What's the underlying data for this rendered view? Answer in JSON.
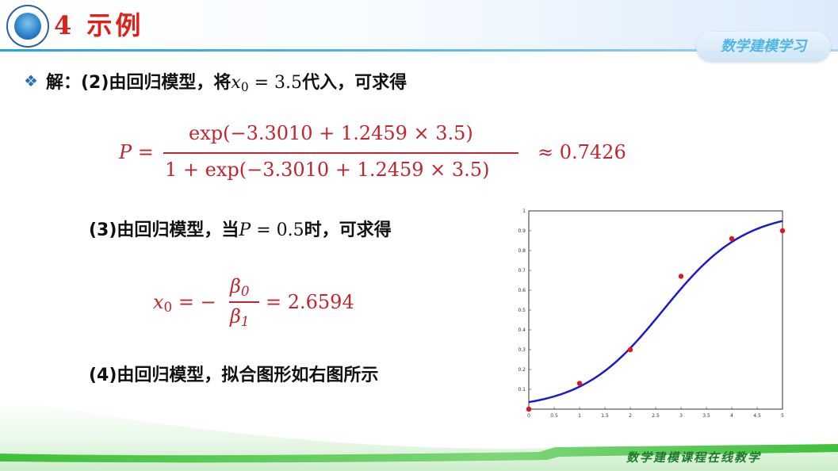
{
  "header": {
    "section_title": "4 示例",
    "course_badge": "数学建模学习"
  },
  "content": {
    "bullet_icon": "diamond-bullet-icon",
    "line1_prefix": "解：(2)由回归模型，将",
    "line1_var": "x",
    "line1_sub": "0",
    "line1_value": " = 3.5",
    "line1_suffix": "代入，可求得",
    "eq_p": {
      "lhs": "P =",
      "numerator": "exp(−3.3010 + 1.2459 × 3.5)",
      "denominator": "1 + exp(−3.3010 + 1.2459 × 3.5)",
      "result": "≈ 0.7426"
    },
    "line3_prefix": "(3)由回归模型，当",
    "line3_var": "P",
    "line3_value": " = 0.5",
    "line3_suffix": "时，可求得",
    "eq_x0": {
      "lhs_var": "x",
      "lhs_sub": "0",
      "lhs_eq": " = −",
      "frac_num_var": "β",
      "frac_num_sub": "0",
      "frac_den_var": "β",
      "frac_den_sub": "1",
      "rhs": "= 2.6594"
    },
    "line4": "(4)由回归模型，拟合图形如右图所示"
  },
  "chart_data": {
    "type": "scatter",
    "xlim": [
      0,
      5
    ],
    "ylim": [
      0,
      1
    ],
    "x_ticks": [
      "0",
      "0.5",
      "1",
      "1.5",
      "2",
      "2.5",
      "3",
      "3.5",
      "4",
      "4.5",
      "5"
    ],
    "y_ticks": [
      "0.1",
      "0.2",
      "0.3",
      "0.4",
      "0.5",
      "0.6",
      "0.7",
      "0.8",
      "0.9",
      "1"
    ],
    "points": [
      {
        "x": 0,
        "y": 0
      },
      {
        "x": 1,
        "y": 0.13
      },
      {
        "x": 2,
        "y": 0.3
      },
      {
        "x": 3,
        "y": 0.67
      },
      {
        "x": 4,
        "y": 0.86
      },
      {
        "x": 5,
        "y": 0.9
      }
    ],
    "curve": {
      "intercept": -3.301,
      "slope": 1.2459
    },
    "point_color": "#e0141e",
    "curve_color": "#1a1ad0",
    "grid": false
  },
  "footer": {
    "text": "数学建模课程在线教学"
  }
}
